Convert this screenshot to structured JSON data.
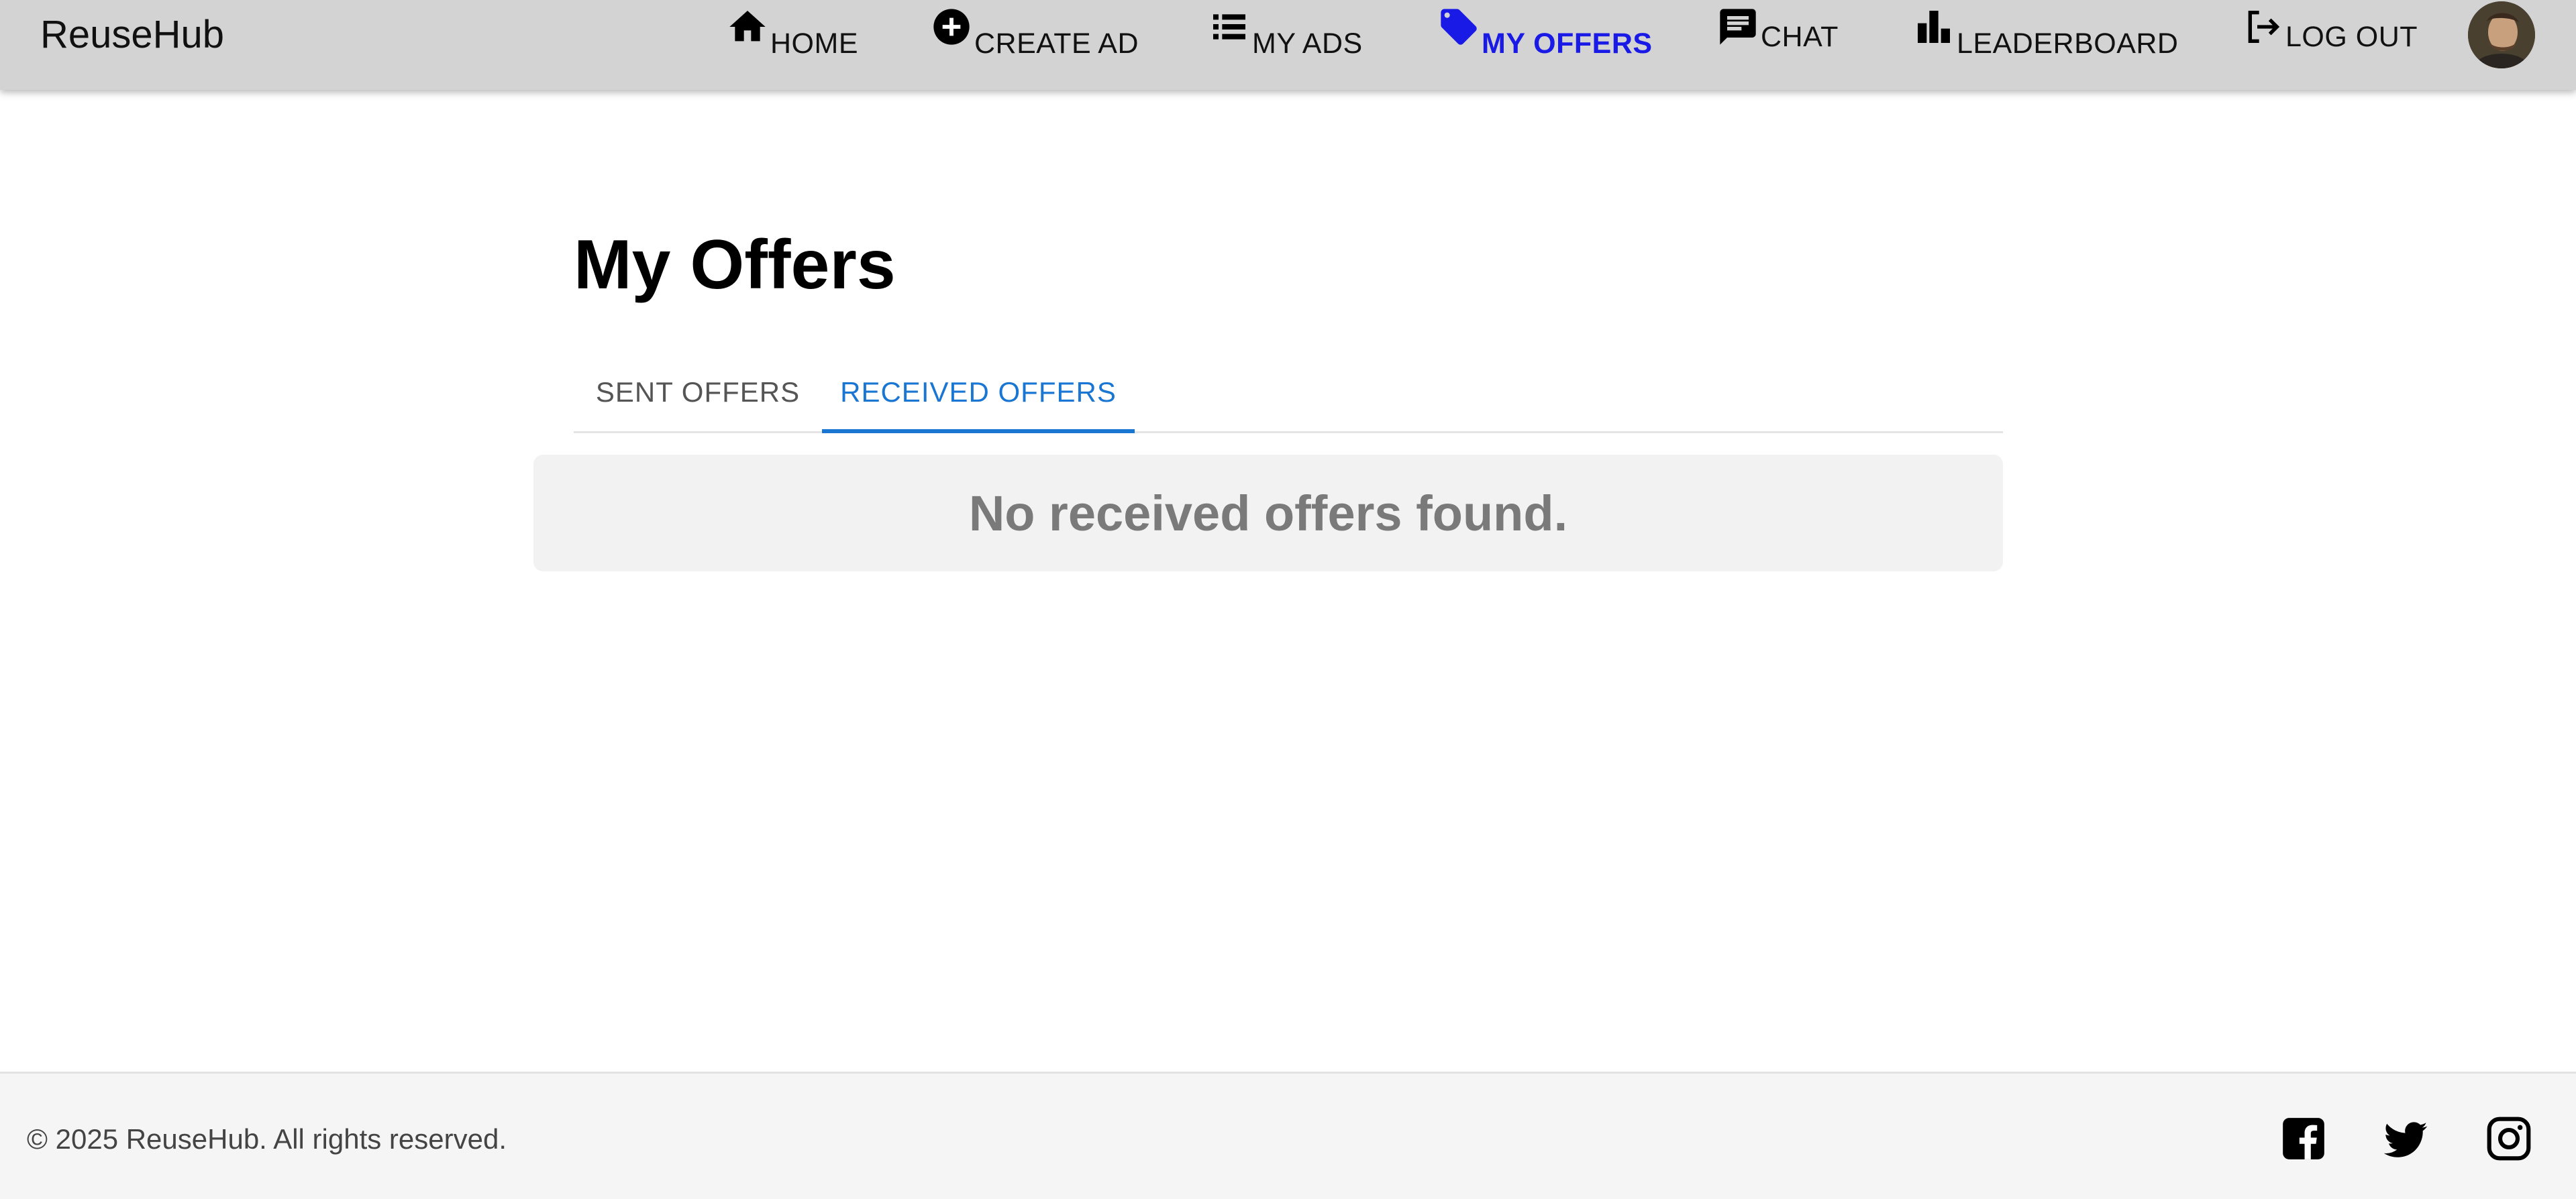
{
  "app": {
    "brand": "ReuseHub"
  },
  "nav": {
    "items": [
      {
        "label": "HOME",
        "icon": "home-icon"
      },
      {
        "label": "CREATE AD",
        "icon": "add-circle-icon"
      },
      {
        "label": "MY ADS",
        "icon": "list-icon"
      },
      {
        "label": "MY OFFERS",
        "icon": "tag-icon",
        "active": true
      },
      {
        "label": "CHAT",
        "icon": "chat-icon"
      },
      {
        "label": "LEADERBOARD",
        "icon": "leaderboard-icon"
      },
      {
        "label": "LOG OUT",
        "icon": "logout-icon"
      }
    ],
    "active_color": "#1a1ae6"
  },
  "page": {
    "title": "My Offers",
    "tabs": [
      {
        "label": "SENT OFFERS",
        "selected": false
      },
      {
        "label": "RECEIVED OFFERS",
        "selected": true
      }
    ],
    "empty_message": "No received offers found.",
    "accent_color": "#1976d2"
  },
  "footer": {
    "copyright": "© 2025 ReuseHub. All rights reserved.",
    "social": [
      "facebook-icon",
      "twitter-icon",
      "instagram-icon"
    ]
  }
}
